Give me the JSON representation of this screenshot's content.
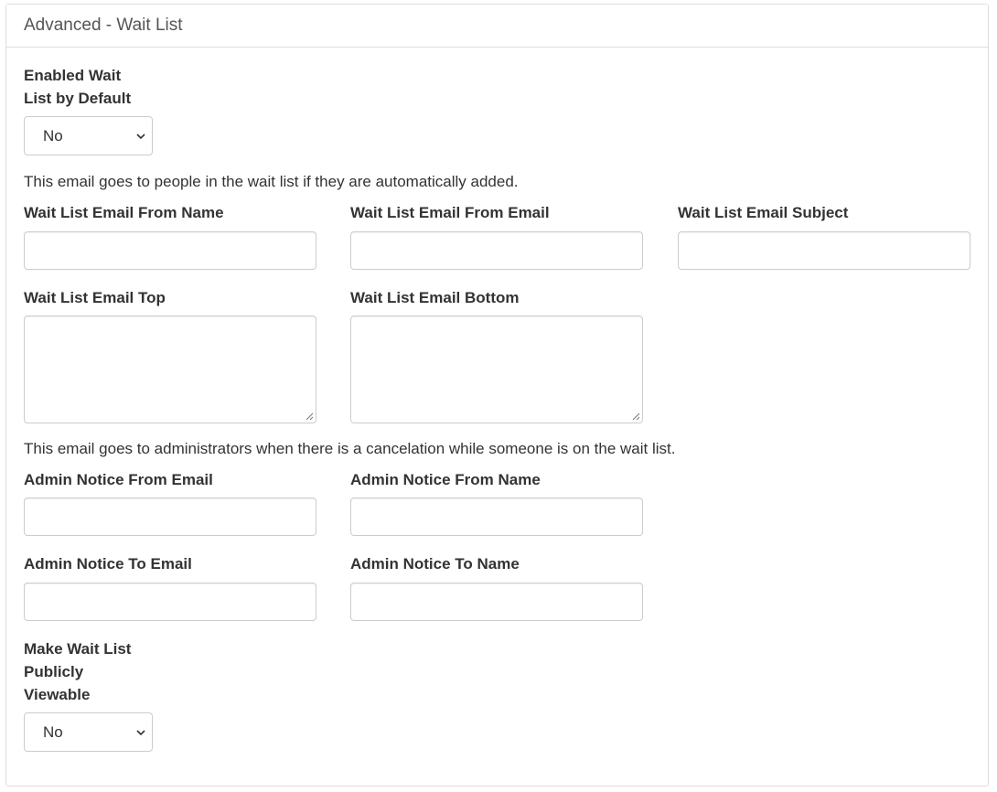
{
  "panel": {
    "title": "Advanced - Wait List"
  },
  "fields": {
    "enabled_default": {
      "label_line1": "Enabled Wait",
      "label_line2": "List by Default",
      "value": "No"
    },
    "help_waitlist": "This email goes to people in the wait list if they are automatically added.",
    "wl_from_name": {
      "label": "Wait List Email From Name",
      "value": ""
    },
    "wl_from_email": {
      "label": "Wait List Email From Email",
      "value": ""
    },
    "wl_subject": {
      "label": "Wait List Email Subject",
      "value": ""
    },
    "wl_top": {
      "label": "Wait List Email Top",
      "value": ""
    },
    "wl_bottom": {
      "label": "Wait List Email Bottom",
      "value": ""
    },
    "help_admin": "This email goes to administrators when there is a cancelation while someone is on the wait list.",
    "admin_from_email": {
      "label": "Admin Notice From Email",
      "value": ""
    },
    "admin_from_name": {
      "label": "Admin Notice From Name",
      "value": ""
    },
    "admin_to_email": {
      "label": "Admin Notice To Email",
      "value": ""
    },
    "admin_to_name": {
      "label": "Admin Notice To Name",
      "value": ""
    },
    "public_viewable": {
      "label_line1": "Make Wait List",
      "label_line2": "Publicly",
      "label_line3": "Viewable",
      "value": "No"
    }
  },
  "icons": {
    "select_arrow": "chevron-down-icon",
    "resize": "resize-grip-icon"
  }
}
